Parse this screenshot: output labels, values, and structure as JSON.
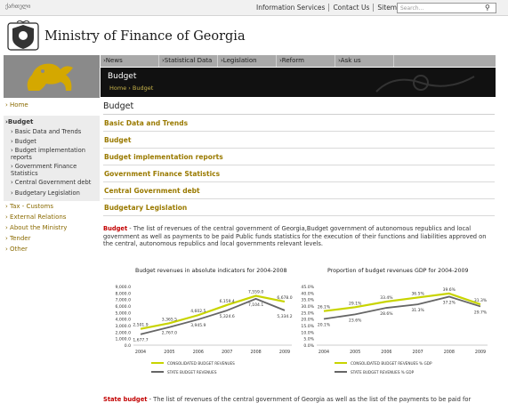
{
  "topbar": {
    "lang": "ქართული",
    "links": [
      "Information Services",
      "Contact Us",
      "Sitemap"
    ],
    "search_placeholder": "Search..."
  },
  "header": {
    "title": "Ministry of Finance of Georgia"
  },
  "nav": [
    "›News",
    "›Statistical Data",
    "›Legislation",
    "›Reform",
    "›Ask us"
  ],
  "banner": {
    "title": "Budget",
    "breadcrumb": "Home › Budget"
  },
  "sidebar": {
    "items": [
      {
        "label": "› Home",
        "active": false
      },
      {
        "label": "›Budget",
        "active": true
      },
      {
        "label": "› Basic Data and Trends",
        "sub": true
      },
      {
        "label": "› Budget",
        "sub": true
      },
      {
        "label": "› Budget implementation reports",
        "sub": true
      },
      {
        "label": "› Government Finance Statistics",
        "sub": true
      },
      {
        "label": "› Central Government debt",
        "sub": true
      },
      {
        "label": "› Budgetary Legislation",
        "sub": true
      },
      {
        "label": "› Tax - Customs",
        "active": false
      },
      {
        "label": "› External Relations",
        "active": false
      },
      {
        "label": "› About the Ministry",
        "active": false
      },
      {
        "label": "› Tender",
        "active": false
      },
      {
        "label": "› Other",
        "active": false
      }
    ]
  },
  "main": {
    "title": "Budget",
    "sections": [
      "Basic Data and Trends",
      "Budget",
      "Budget implementation reports",
      "Government Finance Statistics",
      "Central Government debt",
      "Budgetary Legislation"
    ],
    "para_label": "Budget",
    "para_text": " - The list of revenues of the central government of Georgia,Budget government of autonomous republics and local government as well as payments to be paid Public funds statistics for the execution of their functions and liabilities approved on the central, autonomous republics and local governments relevant levels.",
    "para2_label": "State budget",
    "para2_text": " - The list of revenues of the central government of Georgia as well as the list of the payments to be paid for"
  },
  "chart_data": [
    {
      "type": "line",
      "title": "Budget revenues in absolute indicators for 2004-2008",
      "categories": [
        "2004",
        "2005",
        "2006",
        "2007",
        "2008",
        "2009"
      ],
      "ylim": [
        0,
        9000
      ],
      "yticks": [
        "0.0",
        "1,000.0",
        "2,000.0",
        "3,000.0",
        "4,000.0",
        "5,000.0",
        "6,000.0",
        "7,000.0",
        "8,000.0",
        "9,000.0"
      ],
      "series": [
        {
          "name": "CONSOLIDATED BUDGET REVENUES",
          "color": "#c8d400",
          "values": [
            2501.9,
            3365.5,
            4602.5,
            6159.4,
            7559.0,
            6678.0
          ],
          "labels": [
            "2,501.9",
            "3,365.5",
            "4,602.5",
            "6,159.4",
            "7,559.0",
            "6,678.0"
          ]
        },
        {
          "name": "STATE BUDGET REVENUES",
          "color": "#666666",
          "values": [
            1677.7,
            2767.0,
            3945.9,
            5324.6,
            7104.1,
            5334.2
          ],
          "labels": [
            "1,677.7",
            "2,767.0",
            "3,945.9",
            "5,324.6",
            "7,104.1",
            "5,334.2"
          ]
        }
      ]
    },
    {
      "type": "line",
      "title": "Proportion of budget revenues GDP for 2004-2009",
      "categories": [
        "2004",
        "2005",
        "2006",
        "2007",
        "2008",
        "2009"
      ],
      "ylim": [
        0,
        45
      ],
      "yticks": [
        "0.0%",
        "5.0%",
        "10.0%",
        "15.0%",
        "20.0%",
        "25.0%",
        "30.0%",
        "35.0%",
        "40.0%",
        "45.0%"
      ],
      "series": [
        {
          "name": "CONSOLIDATED BUDGET REVENUES % GDP",
          "color": "#c8d400",
          "values": [
            26.1,
            29.1,
            33.4,
            36.5,
            39.6,
            31.3
          ],
          "labels": [
            "26.1%",
            "29.1%",
            "33.4%",
            "36.5%",
            "39.6%",
            "31.3%"
          ]
        },
        {
          "name": "STATE BUDGET REVENUES % GDP",
          "color": "#666666",
          "values": [
            20.1,
            23.6,
            28.6,
            31.3,
            37.2,
            29.7
          ],
          "labels": [
            "20.1%",
            "23.6%",
            "28.6%",
            "31.3%",
            "37.2%",
            "29.7%"
          ]
        }
      ]
    }
  ]
}
